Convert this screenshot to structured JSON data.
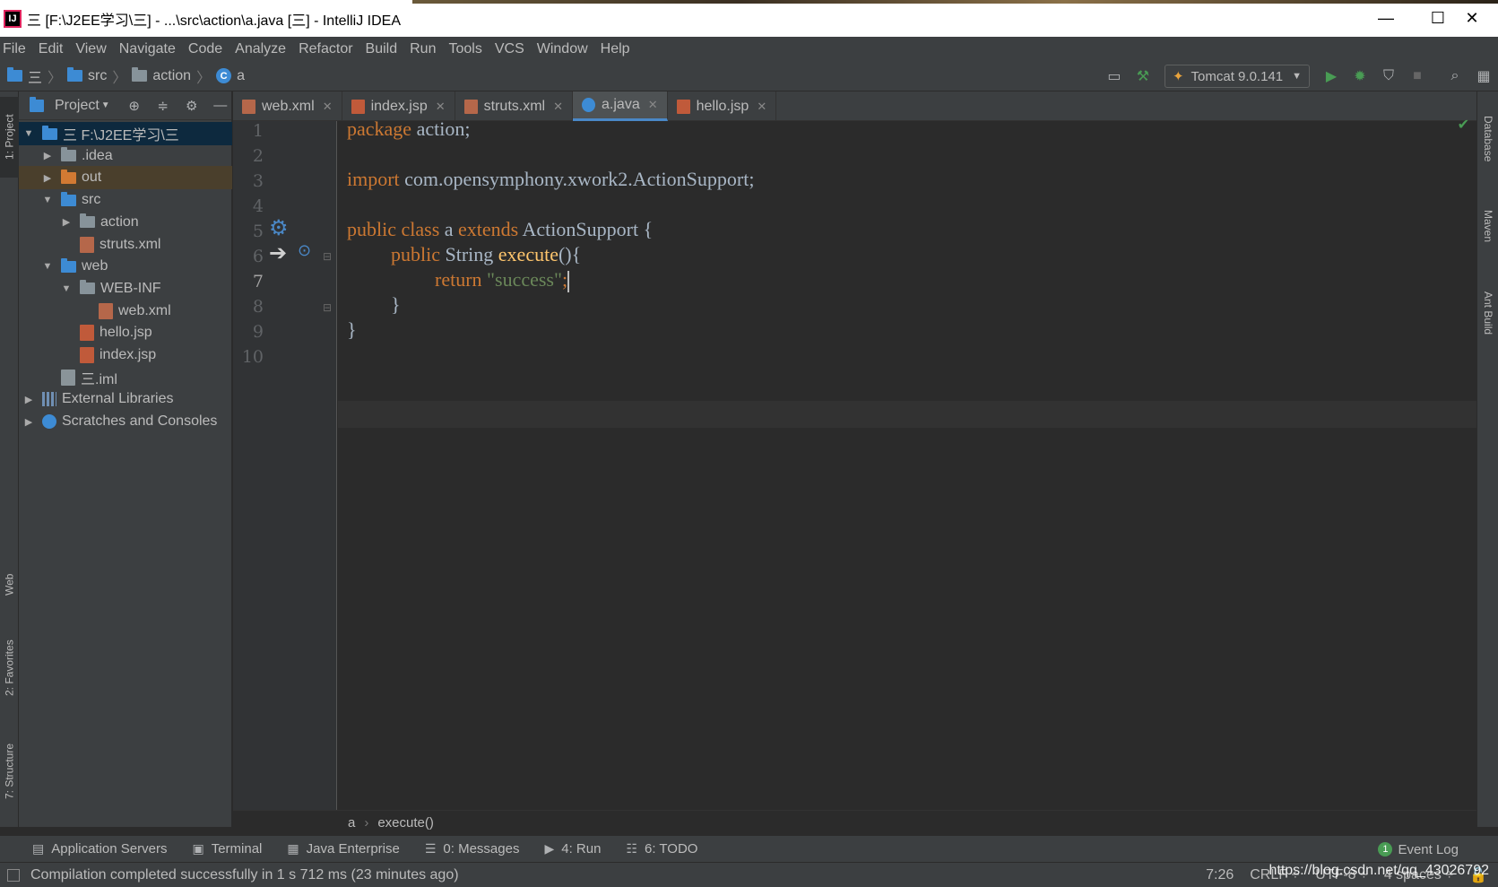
{
  "window": {
    "title": "三 [F:\\J2EE学习\\三] - ...\\src\\action\\a.java [三] - IntelliJ IDEA",
    "app_icon_label": "IJ",
    "minimize": "—",
    "maximize": "☐",
    "close": "✕"
  },
  "menu": [
    "File",
    "Edit",
    "View",
    "Navigate",
    "Code",
    "Analyze",
    "Refactor",
    "Build",
    "Run",
    "Tools",
    "VCS",
    "Window",
    "Help"
  ],
  "navbar": {
    "root": "三",
    "crumbs": [
      "src",
      "action",
      "a"
    ],
    "run_config": "Tomcat 9.0.141"
  },
  "left_stripe": {
    "project": "1: Project",
    "web": "Web",
    "favorites": "2: Favorites",
    "structure": "7: Structure"
  },
  "right_stripe": {
    "database": "Database",
    "maven": "Maven",
    "ant": "Ant Build"
  },
  "project": {
    "title": "Project",
    "tree": [
      {
        "label": "三  F:\\J2EE学习\\三",
        "depth": 0,
        "toggle": "▼",
        "icon": "module-folder-icon",
        "state": "selected"
      },
      {
        "label": ".idea",
        "depth": 1,
        "toggle": "▶",
        "icon": "folder-icon"
      },
      {
        "label": "out",
        "depth": 1,
        "toggle": "▶",
        "icon": "excluded-folder-icon",
        "state": "excluded"
      },
      {
        "label": "src",
        "depth": 1,
        "toggle": "▼",
        "icon": "source-folder-icon"
      },
      {
        "label": "action",
        "depth": 2,
        "toggle": "▶",
        "icon": "package-icon"
      },
      {
        "label": "struts.xml",
        "depth": 2,
        "toggle": "",
        "icon": "xml-file-icon"
      },
      {
        "label": "web",
        "depth": 1,
        "toggle": "▼",
        "icon": "web-folder-icon"
      },
      {
        "label": "WEB-INF",
        "depth": 2,
        "toggle": "▼",
        "icon": "folder-icon"
      },
      {
        "label": "web.xml",
        "depth": 3,
        "toggle": "",
        "icon": "xml-file-icon"
      },
      {
        "label": "hello.jsp",
        "depth": 2,
        "toggle": "",
        "icon": "jsp-file-icon"
      },
      {
        "label": "index.jsp",
        "depth": 2,
        "toggle": "",
        "icon": "jsp-file-icon"
      },
      {
        "label": "三.iml",
        "depth": 1,
        "toggle": "",
        "icon": "iml-file-icon"
      },
      {
        "label": "External Libraries",
        "depth": 0,
        "toggle": "▶",
        "icon": "libraries-icon"
      },
      {
        "label": "Scratches and Consoles",
        "depth": 0,
        "toggle": "▶",
        "icon": "scratches-icon"
      }
    ]
  },
  "tabs": [
    {
      "label": "web.xml",
      "icon": "xml",
      "active": false
    },
    {
      "label": "index.jsp",
      "icon": "jsp",
      "active": false
    },
    {
      "label": "struts.xml",
      "icon": "xml",
      "active": false
    },
    {
      "label": "a.java",
      "icon": "java",
      "active": true
    },
    {
      "label": "hello.jsp",
      "icon": "jsp",
      "active": false
    }
  ],
  "editor": {
    "line_numbers": [
      "1",
      "2",
      "3",
      "4",
      "5",
      "6",
      "7",
      "8",
      "9",
      "10"
    ],
    "current_line": "7",
    "code": {
      "l1_kw": "package",
      "l1_rest": " action;",
      "l3_kw": "import",
      "l3_rest": " com.opensymphony.xwork2.ActionSupport;",
      "l5_kw1": "public class",
      "l5_name": " a ",
      "l5_kw2": "extends",
      "l5_rest": " ActionSupport {",
      "l6_kw": "public",
      "l6_type": " String ",
      "l6_fn": "execute",
      "l6_rest": "(){",
      "l7_kw": "return",
      "l7_str": " \"success\"",
      "l7_rest": ";",
      "l8": "}",
      "l9": "}"
    }
  },
  "breadcrumb_bar": [
    "a",
    "execute()"
  ],
  "tool_tabs": [
    {
      "label": "Application Servers",
      "icon": "servers-icon"
    },
    {
      "label": "Terminal",
      "icon": "terminal-icon"
    },
    {
      "label": "Java Enterprise",
      "icon": "java-enterprise-icon"
    },
    {
      "label": "0: Messages",
      "icon": "messages-icon"
    },
    {
      "label": "4: Run",
      "icon": "run-icon"
    },
    {
      "label": "6: TODO",
      "icon": "todo-icon"
    }
  ],
  "event_log": {
    "label": "Event Log",
    "count": "1"
  },
  "status": {
    "message": "Compilation completed successfully in 1 s 712 ms (23 minutes ago)",
    "position": "7:26",
    "line_sep": "CRLF ÷",
    "encoding": "UTF-8 ÷",
    "indent": "4 spaces ÷"
  },
  "watermark": "https://blog.csdn.net/qq_43026792",
  "colors": {
    "keyword": "#cc7832",
    "string": "#6a8759",
    "function": "#ffc66d",
    "text": "#a9b7c6",
    "accent": "#4a88c7",
    "run_green": "#499c54"
  }
}
